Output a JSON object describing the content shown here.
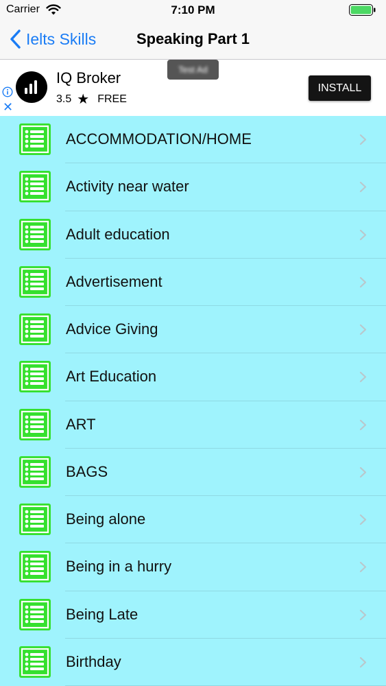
{
  "status_bar": {
    "carrier": "Carrier",
    "time": "7:10 PM"
  },
  "nav": {
    "back_label": "Ielts Skills",
    "title": "Speaking Part 1"
  },
  "ad": {
    "app_name": "IQ Broker",
    "rating": "3.5",
    "price": "FREE",
    "install_label": "INSTALL",
    "blurred_tag": "Test Ad"
  },
  "topics": [
    {
      "label": "ACCOMMODATION/HOME"
    },
    {
      "label": "Activity near water"
    },
    {
      "label": "Adult education"
    },
    {
      "label": "Advertisement"
    },
    {
      "label": "Advice Giving"
    },
    {
      "label": "Art Education"
    },
    {
      "label": "ART"
    },
    {
      "label": "BAGS"
    },
    {
      "label": "Being alone"
    },
    {
      "label": "Being in a hurry"
    },
    {
      "label": "Being Late"
    },
    {
      "label": "Birthday"
    }
  ],
  "colors": {
    "accent": "#1a7cf5",
    "list_background": "#9ff3fd",
    "icon_green": "#35e02e",
    "battery_green": "#4cd964"
  }
}
